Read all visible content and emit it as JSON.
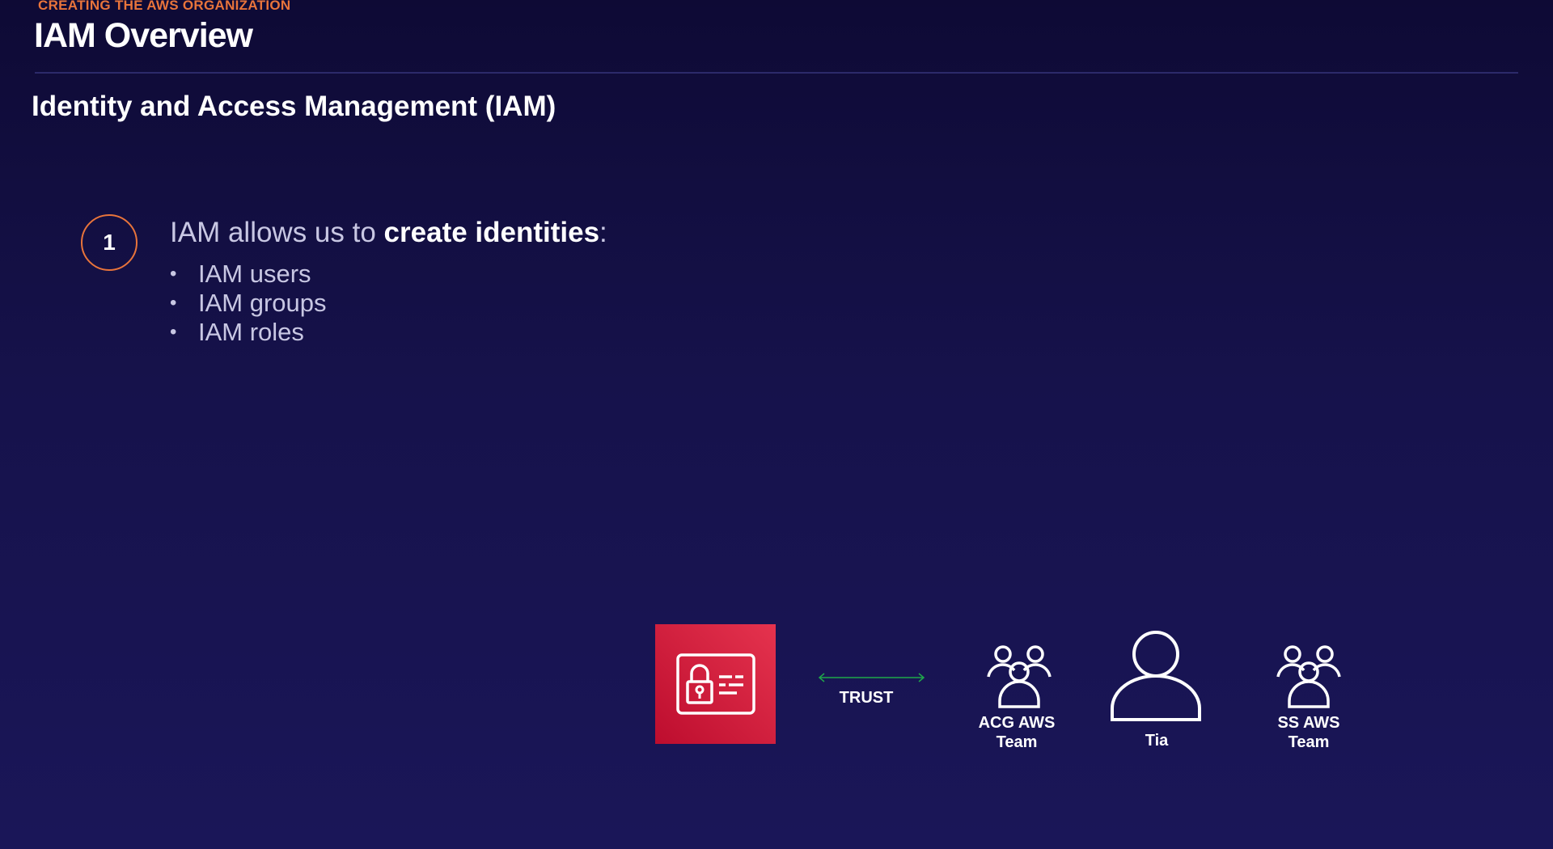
{
  "header": {
    "eyebrow": "CREATING THE AWS ORGANIZATION",
    "title": "IAM Overview"
  },
  "subtitle": "Identity and Access Management (IAM)",
  "point": {
    "number": "1",
    "text_before": "IAM allows us to ",
    "text_bold": "create identities",
    "text_after": ":",
    "bullets": [
      "IAM users",
      "IAM groups",
      "IAM roles"
    ]
  },
  "diagram": {
    "iam_icon": "iam-id-card-lock-icon",
    "trust_label": "TRUST",
    "entities": [
      {
        "icon": "group-icon",
        "label_line1": "ACG AWS",
        "label_line2": "Team"
      },
      {
        "icon": "user-icon",
        "label": "Tia"
      },
      {
        "icon": "group-icon",
        "label_line1": "SS AWS",
        "label_line2": "Team"
      }
    ]
  },
  "colors": {
    "background": "#16124b",
    "accent_orange": "#e8743b",
    "iam_red": "#d2203f",
    "trust_green": "#1fa84a"
  }
}
